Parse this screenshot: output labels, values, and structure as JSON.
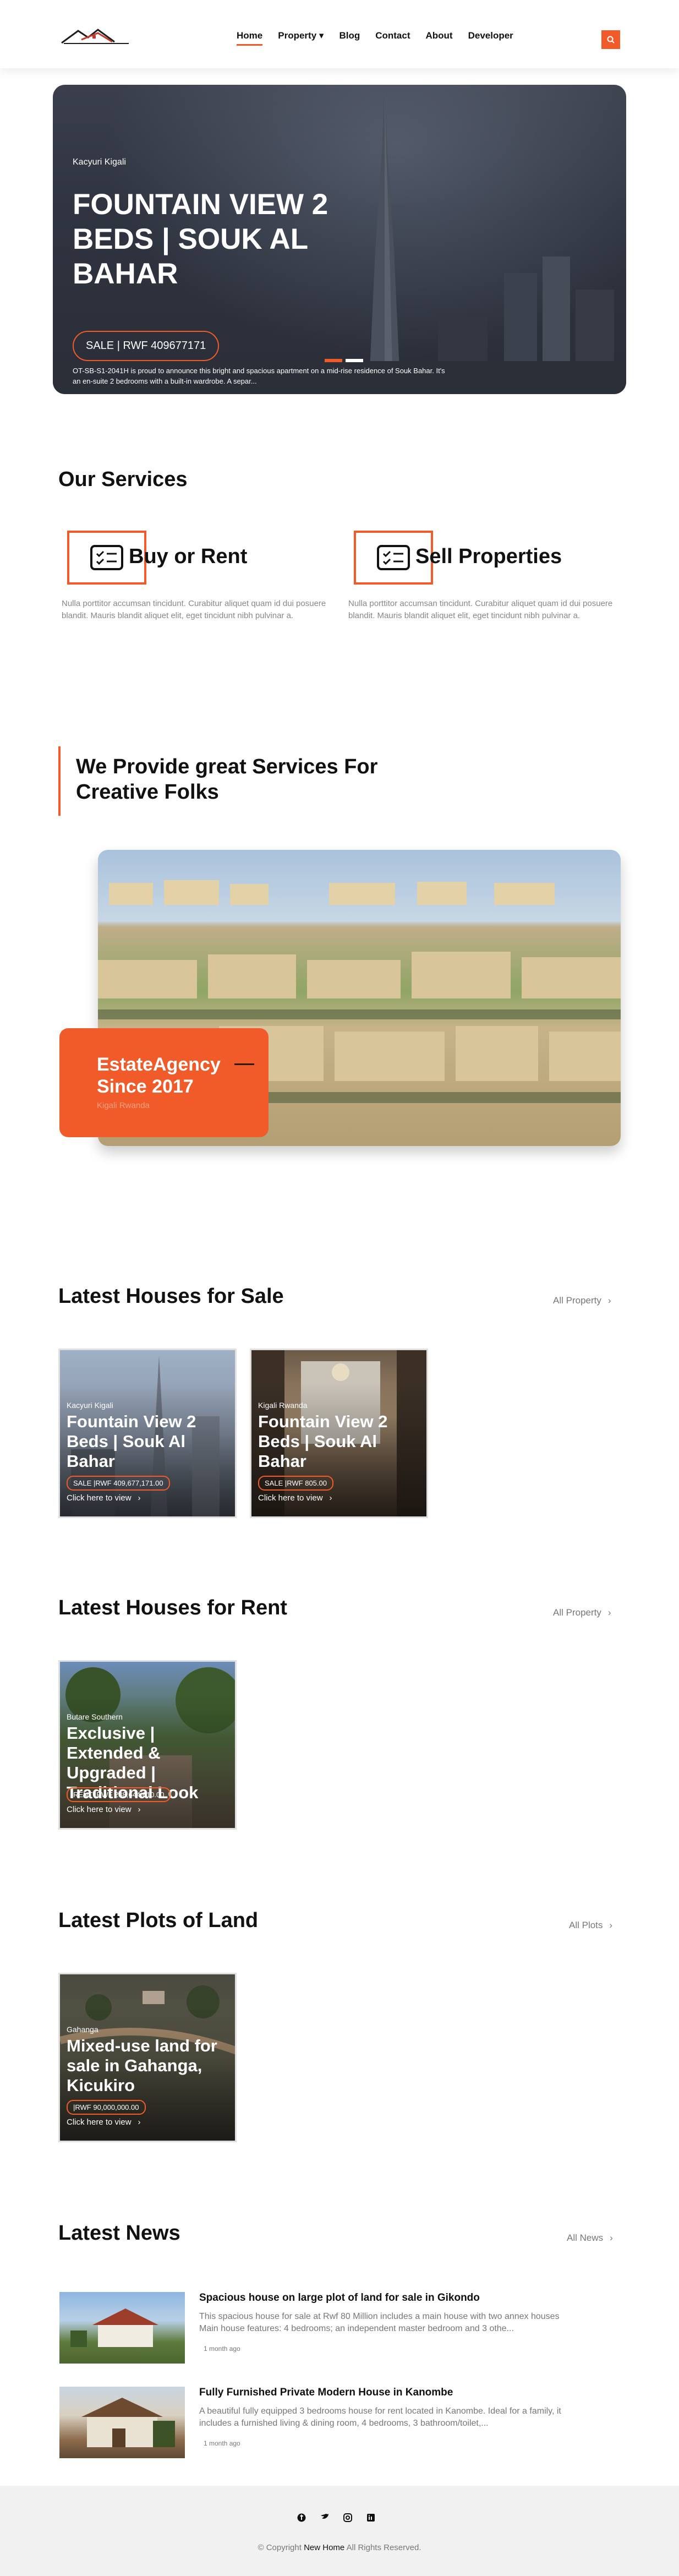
{
  "nav": {
    "items": [
      "Home",
      "Property",
      "Blog",
      "Contact",
      "About",
      "Developer"
    ],
    "active": "Home"
  },
  "hero": {
    "location": "Kacyuri Kigali",
    "title": "FOUNTAIN VIEW 2 BEDS | SOUK AL BAHAR",
    "price": "SALE | RWF 409677171",
    "description": "OT-SB-S1-2041H is proud to announce this bright and spacious apartment on a mid-rise residence of Souk Bahar. It's an en-suite 2 bedrooms with a built-in wardrobe. A separ..."
  },
  "services": {
    "heading": "Our Services",
    "items": [
      {
        "title": "Buy or Rent",
        "desc": "Nulla porttitor accumsan tincidunt. Curabitur aliquet quam id dui posuere blandit. Mauris blandit aliquet elit, eget tincidunt nibh pulvinar a."
      },
      {
        "title": "Sell Properties",
        "desc": "Nulla porttitor accumsan tincidunt. Curabitur aliquet quam id dui posuere blandit. Mauris blandit aliquet elit, eget tincidunt nibh pulvinar a."
      }
    ]
  },
  "provide": {
    "title": "We Provide great Services For Creative Folks",
    "card_title": "EstateAgency Since 2017",
    "card_location": "Kigali Rwanda"
  },
  "sale": {
    "heading": "Latest Houses for Sale",
    "link": "All Property",
    "cards": [
      {
        "location": "Kacyuri Kigali",
        "title": "Fountain View 2 Beds | Souk Al Bahar",
        "price": "SALE |RWF 409,677,171.00",
        "cta": "Click here to view"
      },
      {
        "location": "Kigali Rwanda",
        "title": "Fountain View 2 Beds | Souk Al Bahar",
        "price": "SALE |RWF 805.00",
        "cta": "Click here to view"
      }
    ]
  },
  "rent": {
    "heading": "Latest Houses for Rent",
    "link": "All Property",
    "cards": [
      {
        "location": "Butare Southern",
        "title": "Exclusive | Extended & Upgraded | Traditional Look",
        "price": "RENT |RWF 238,644,610.00",
        "cta": "Click here to view"
      }
    ]
  },
  "plots": {
    "heading": "Latest Plots of Land",
    "link": "All Plots",
    "cards": [
      {
        "location": "Gahanga",
        "title": "Mixed-use land for sale in Gahanga, Kicukiro",
        "price": "|RWF 90,000,000.00",
        "cta": "Click here to view"
      }
    ]
  },
  "news": {
    "heading": "Latest News",
    "link": "All News",
    "items": [
      {
        "title": "Spacious house on large plot of land for sale in Gikondo",
        "desc": "This spacious house for sale at Rwf 80 Million includes a main house with two annex houses Main house features: 4 bedrooms; an independent master bedroom and 3 othe...",
        "time": "1 month ago"
      },
      {
        "title": "Fully Furnished Private Modern House in Kanombe",
        "desc": "A beautiful fully equipped 3 bedrooms house for rent located in Kanombe. Ideal for a family, it includes a furnished living & dining room, 4 bedrooms, 3 bathroom/toilet,...",
        "time": "1 month ago"
      }
    ]
  },
  "footer": {
    "copy_prefix": "© Copyright",
    "brand": "New Home",
    "copy_suffix": "All Rights Reserved."
  },
  "colors": {
    "accent": "#f15a29"
  }
}
